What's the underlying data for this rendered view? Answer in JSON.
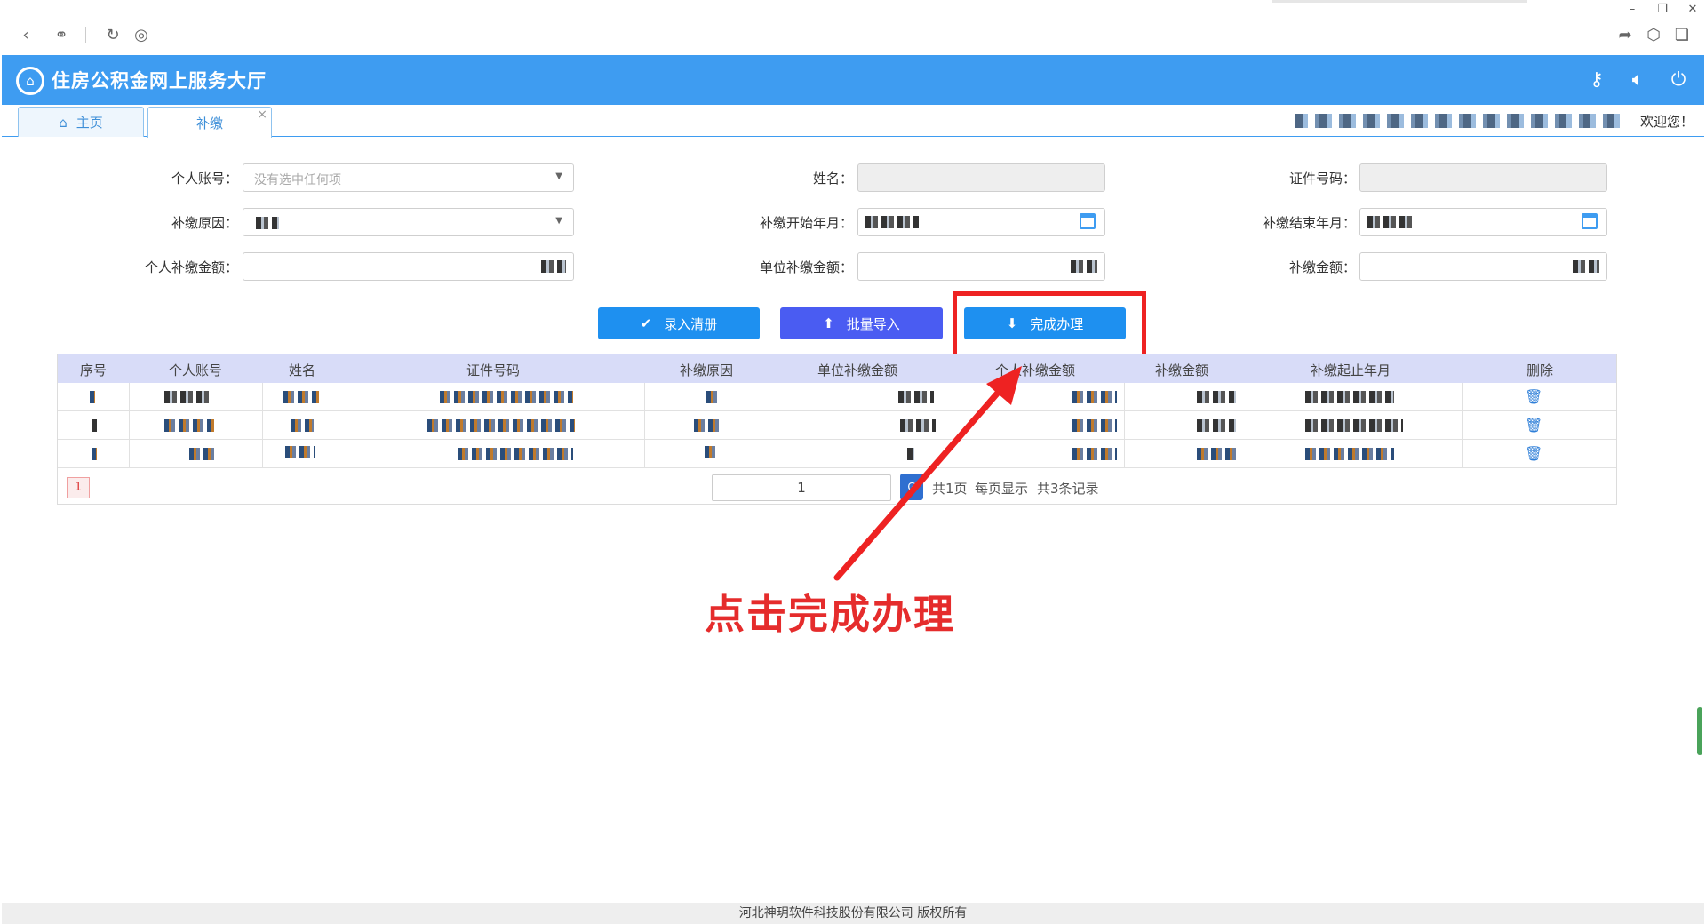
{
  "chrome": {
    "back_icon": "chevron-left-icon",
    "link_icon": "link-icon",
    "reload_icon": "reload-icon",
    "globe_icon": "globe-icon",
    "share_icon": "share-icon",
    "cube_icon": "cube-icon",
    "window_icon": "window-icon"
  },
  "header": {
    "title": "住房公积金网上服务大厅",
    "icons": [
      "key-icon",
      "speaker-icon",
      "power-icon"
    ],
    "accent": "#3e9cf1"
  },
  "tabs": [
    {
      "label": "主页",
      "icon": "home-icon"
    },
    {
      "label": "补缴",
      "close": "×"
    }
  ],
  "user": {
    "welcome": "欢迎您！"
  },
  "form": {
    "personal_account_label": "个人账号：",
    "personal_account_placeholder": "没有选中任何项",
    "name_label": "姓名：",
    "id_number_label": "证件号码：",
    "reason_label": "补缴原因：",
    "start_month_label": "补缴开始年月：",
    "end_month_label": "补缴结束年月：",
    "personal_amount_label": "个人补缴金额：",
    "unit_amount_label": "单位补缴金额：",
    "total_amount_label": "补缴金额："
  },
  "buttons": {
    "enter_list": "录入清册",
    "batch_import": "批量导入",
    "complete": "完成办理",
    "colors": {
      "enter_list": "#1e90f0",
      "batch_import": "#4a5cf2",
      "complete": "#1e90f0"
    }
  },
  "table": {
    "columns": [
      "序号",
      "个人账号",
      "姓名",
      "证件号码",
      "补缴原因",
      "单位补缴金额",
      "个人补缴金额",
      "补缴金额",
      "补缴起止年月",
      "删除"
    ],
    "row_count": 3
  },
  "pager": {
    "current": "1",
    "input_value": "1",
    "go": "G",
    "total_pages": "共1页",
    "per_page": "每页显示",
    "total_records": "共3条记录"
  },
  "annotation": {
    "text": "点击完成办理",
    "color": "#e52c2c"
  },
  "footer": {
    "text": "河北神玥软件科技股份有限公司 版权所有"
  }
}
